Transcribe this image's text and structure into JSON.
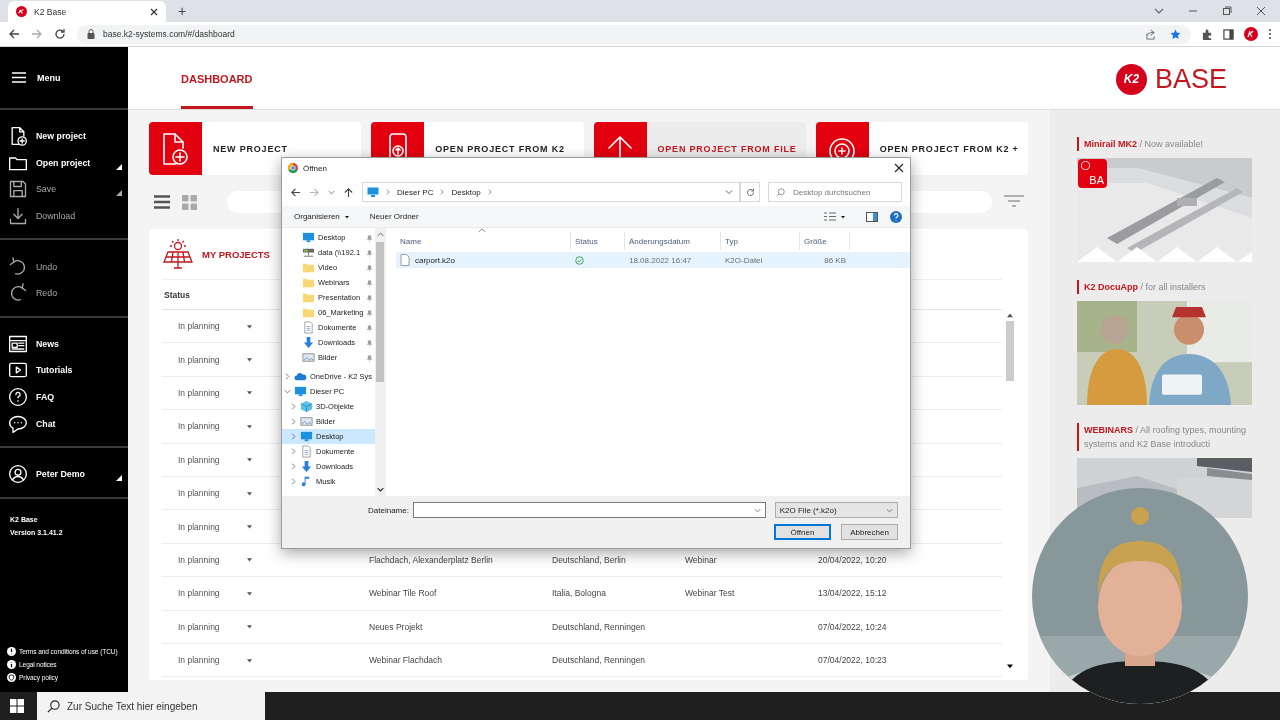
{
  "browser": {
    "tab_title": "K2 Base",
    "new_tab": "+",
    "url": "base.k2-systems.com/#/dashboard"
  },
  "sidebar": {
    "menu_label": "Menu",
    "groups": [
      [
        {
          "label": "New project",
          "disabled": false,
          "submenu": false
        },
        {
          "label": "Open project",
          "disabled": false,
          "submenu": true
        },
        {
          "label": "Save",
          "disabled": true,
          "submenu": true
        },
        {
          "label": "Download",
          "disabled": true,
          "submenu": false
        }
      ],
      [
        {
          "label": "Undo",
          "disabled": true,
          "submenu": false
        },
        {
          "label": "Redo",
          "disabled": true,
          "submenu": false
        }
      ],
      [
        {
          "label": "News",
          "disabled": false,
          "submenu": false
        },
        {
          "label": "Tutorials",
          "disabled": false,
          "submenu": false
        },
        {
          "label": "FAQ",
          "disabled": false,
          "submenu": false
        },
        {
          "label": "Chat",
          "disabled": false,
          "submenu": false
        }
      ]
    ],
    "user": {
      "name": "Peter Demo",
      "submenu": true
    },
    "app_name": "K2 Base",
    "version": "Version 3.1.41.2",
    "legal_links": [
      "Terms and conditions of use (TCU)",
      "Legal notices",
      "Privacy policy"
    ]
  },
  "header": {
    "tabs": [
      {
        "label": "DASHBOARD",
        "selected": true
      }
    ],
    "logo": {
      "mark": "K2",
      "word": "BASE"
    }
  },
  "actions": [
    {
      "label": "NEW PROJECT",
      "hovered": false
    },
    {
      "label": "OPEN PROJECT FROM K2",
      "hovered": false
    },
    {
      "label": "OPEN PROJECT FROM FILE",
      "hovered": true
    },
    {
      "label": "OPEN PROJECT FROM K2 +",
      "hovered": false
    }
  ],
  "projects": {
    "title": "MY PROJECTS",
    "columns": [
      "Status"
    ],
    "rows": [
      {
        "status": "In planning"
      },
      {
        "status": "In planning"
      },
      {
        "status": "In planning"
      },
      {
        "status": "In planning"
      },
      {
        "status": "In planning"
      },
      {
        "status": "In planning"
      },
      {
        "status": "In planning"
      },
      {
        "status": "In planning",
        "name": "Flachdach, Alexanderplatz Berlin",
        "location": "Deutschland, Berlin",
        "column_4": "Webinar",
        "date": "20/04/2022, 10:20"
      },
      {
        "status": "In planning",
        "name": "Webinar Tile Roof",
        "location": "Italia, Bologna",
        "column_4": "Webinar Test",
        "date": "13/04/2022, 15:12"
      },
      {
        "status": "In planning",
        "name": "Neues Projekt",
        "location": "Deutschland, Renningen",
        "date": "07/04/2022, 10:24"
      },
      {
        "status": "In planning",
        "name": "Webinar Flachdach",
        "location": "Deutschland, Renningen",
        "date": "07/04/2022, 10:23"
      }
    ]
  },
  "news": [
    {
      "title": "Minirail MK2",
      "subtitle": "/ Now available!",
      "badge": "BA"
    },
    {
      "title": "K2 DocuApp",
      "subtitle": "/ for all installers"
    },
    {
      "title": "WEBINARS",
      "subtitle": "/ All roofing types, mounting systems and K2 Base introducti"
    }
  ],
  "dialog": {
    "title": "Öffnen",
    "breadcrumb": [
      "Dieser PC",
      "Desktop"
    ],
    "search_placeholder": "Desktop durchsuchen",
    "toolbar": [
      "Organisieren",
      "Neuer Ordner"
    ],
    "tree": [
      {
        "label": "Desktop",
        "kind": "quick",
        "selected": false
      },
      {
        "label": "data (\\\\192.1",
        "kind": "quick",
        "selected": false
      },
      {
        "label": "Video",
        "kind": "quick",
        "selected": false
      },
      {
        "label": "Webinars",
        "kind": "quick",
        "selected": false
      },
      {
        "label": "Presentation",
        "kind": "quick",
        "selected": false
      },
      {
        "label": "06_Marketing",
        "kind": "quick",
        "selected": false
      },
      {
        "label": "Dokumente",
        "kind": "quick",
        "selected": false
      },
      {
        "label": "Downloads",
        "kind": "quick",
        "selected": false
      },
      {
        "label": "Bilder",
        "kind": "quick",
        "selected": false
      },
      {
        "label": "OneDrive - K2 Sys",
        "kind": "node",
        "expanded": false,
        "selected": false
      },
      {
        "label": "Dieser PC",
        "kind": "node",
        "expanded": true,
        "selected": false,
        "children": [
          {
            "label": "3D-Objekte",
            "kind": "node",
            "expanded": false,
            "selected": false
          },
          {
            "label": "Bilder",
            "kind": "node",
            "expanded": false,
            "selected": false
          },
          {
            "label": "Desktop",
            "kind": "node",
            "expanded": false,
            "selected": true
          },
          {
            "label": "Dokumente",
            "kind": "node",
            "expanded": false,
            "selected": false
          },
          {
            "label": "Downloads",
            "kind": "node",
            "expanded": false,
            "selected": false
          },
          {
            "label": "Musik",
            "kind": "node",
            "expanded": false,
            "selected": false
          }
        ]
      }
    ],
    "columns": [
      "Name",
      "Status",
      "Änderungsdatum",
      "Typ",
      "Größe"
    ],
    "files": [
      {
        "name": "carport.k2o",
        "date": "18.08.2022 16:47",
        "type": "K2O-Datei",
        "size": "86 KB",
        "hovered": true
      }
    ],
    "filename_label": "Dateiname:",
    "filetype": "K2O File (*.k2o)",
    "buttons": [
      {
        "label": "Öffnen",
        "default": true
      },
      {
        "label": "Abbrechen",
        "default": false
      }
    ]
  },
  "taskbar": {
    "search_placeholder": "Zur Suche Text hier eingeben"
  }
}
